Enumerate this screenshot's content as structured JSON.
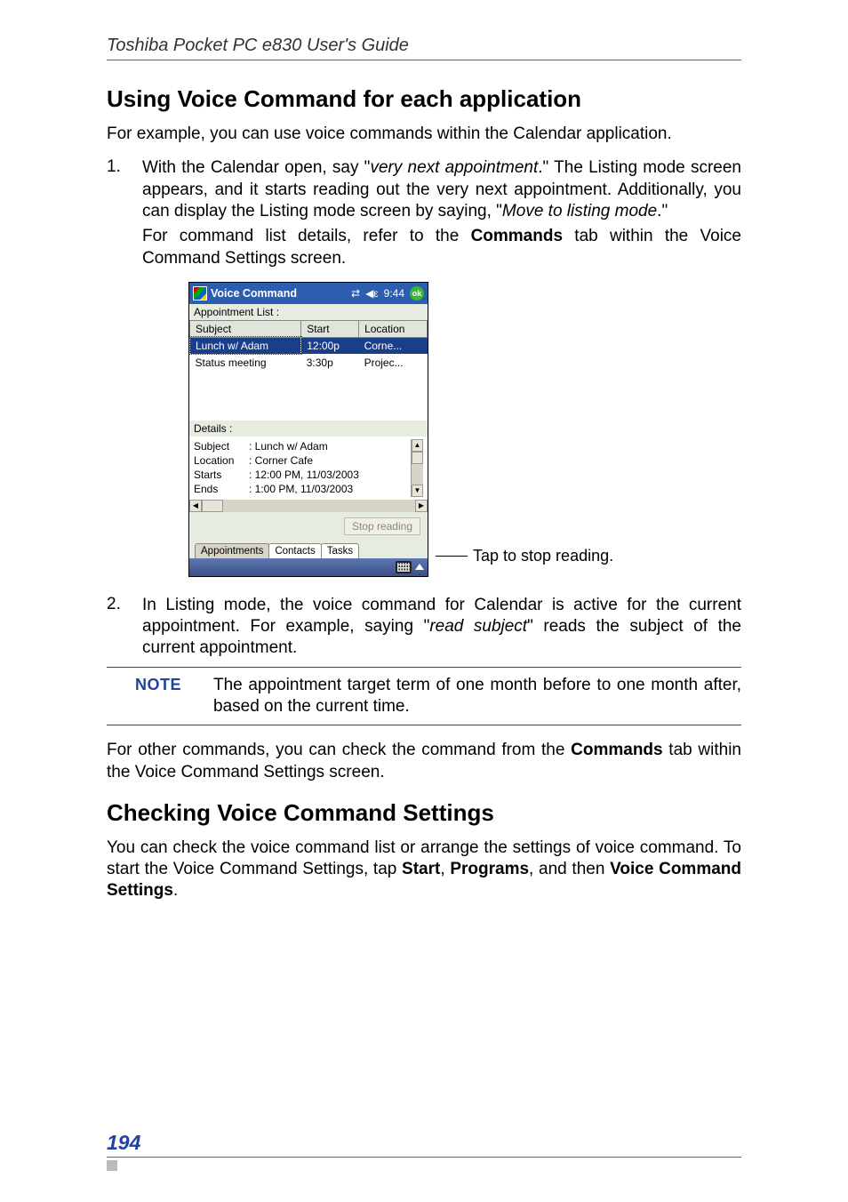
{
  "header": {
    "title": "Toshiba Pocket PC  e830 User's Guide"
  },
  "h2_a": "Using Voice Command for each application",
  "p1": "For example, you can use voice commands within the Calendar application.",
  "list1": {
    "num": "1.",
    "a": "With the Calendar open, say \"",
    "a_em": "very next appointment",
    "a2": ".\" The Listing mode screen appears, and it starts reading out the very next appointment. Additionally, you can display the Listing mode screen by saying, \"",
    "a2_em": "Move to listing mode",
    "a3": ".\"",
    "b1": "For command list details, refer to the ",
    "b_bold": "Commands",
    "b2": " tab within the Voice Command Settings screen."
  },
  "shot": {
    "title": "Voice Command",
    "time": "9:44",
    "ok": "ok",
    "appt_list": "Appointment List :",
    "th": {
      "subject": "Subject",
      "start": "Start",
      "location": "Location"
    },
    "rows": [
      {
        "subject": "Lunch w/ Adam",
        "start": "12:00p",
        "location": "Corne..."
      },
      {
        "subject": "Status meeting",
        "start": "3:30p",
        "location": "Projec..."
      }
    ],
    "details_label": "Details :",
    "details": {
      "subject_k": "Subject",
      "subject_v": ": Lunch w/ Adam",
      "location_k": "Location",
      "location_v": ": Corner Cafe",
      "starts_k": "Starts",
      "starts_v": ": 12:00 PM, 11/03/2003",
      "ends_k": "Ends",
      "ends_v": ": 1:00 PM, 11/03/2003"
    },
    "stop": "Stop reading",
    "tabs": {
      "a": "Appointments",
      "b": "Contacts",
      "c": "Tasks"
    },
    "callout": "Tap to stop reading."
  },
  "list2": {
    "num": "2.",
    "a": "In Listing mode, the voice command for Calendar is active for the current appointment. For example, saying \"",
    "em": "read subject",
    "b": "\" reads the subject of the current appointment."
  },
  "note": {
    "label": "NOTE",
    "text": "The appointment target term of one month before to one month after, based on the current time."
  },
  "p2a": "For other commands, you can check the command from the ",
  "p2b": "Commands",
  "p2c": " tab within the Voice Command Settings screen.",
  "h2_b": "Checking Voice Command Settings",
  "p3a": "You can check the voice command list or arrange the settings of voice command. To start the Voice Command Settings, tap ",
  "p3_b1": "Start",
  "p3_c1": ", ",
  "p3_b2": "Programs",
  "p3_c2": ", and then ",
  "p3_b3": "Voice Command Settings",
  "p3_c3": ".",
  "footer": {
    "page": "194"
  }
}
